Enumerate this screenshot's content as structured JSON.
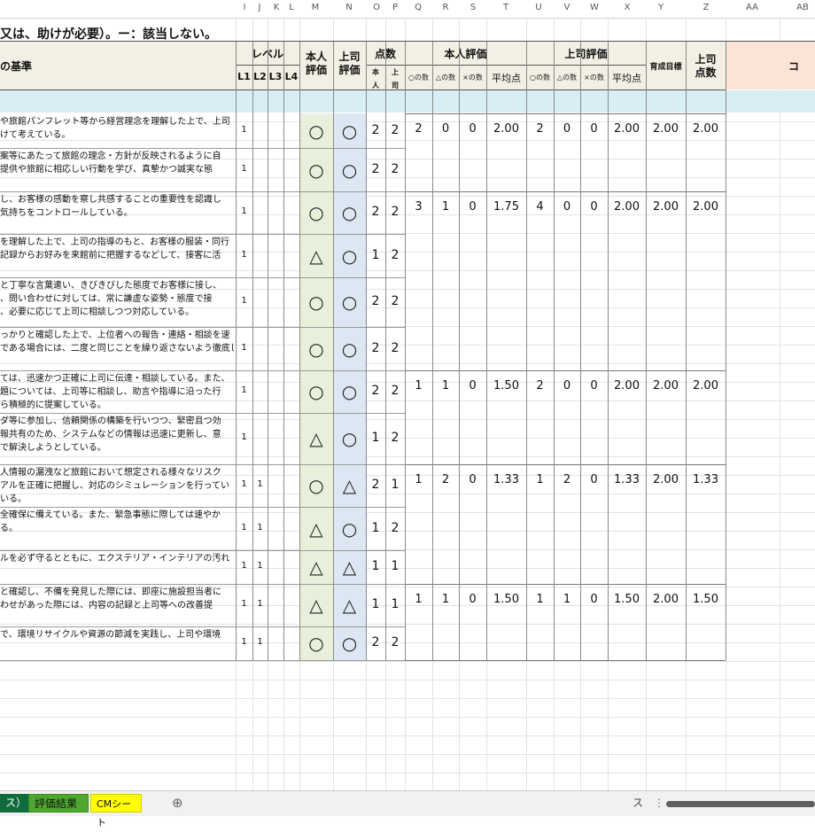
{
  "column_letters": [
    "I",
    "J",
    "K",
    "L",
    "M",
    "N",
    "O",
    "P",
    "Q",
    "R",
    "S",
    "T",
    "U",
    "V",
    "W",
    "X",
    "Y",
    "Z",
    "AA",
    "AB"
  ],
  "title_row": "又は、助けが必要）。ー：該当しない。",
  "headers": {
    "criteria": "の基準",
    "level": "レベル",
    "level_cols": [
      "L1",
      "L2",
      "L3",
      "L4"
    ],
    "self_eval": "本人\n評価",
    "boss_eval": "上司\n評価",
    "points": "点数",
    "points_sub": [
      "本\n人",
      "上\n司"
    ],
    "self_group": "本人評価",
    "boss_group": "上司評価",
    "count_cols": [
      "○の数",
      "△の数",
      "×の数"
    ],
    "avg": "平均点",
    "growth_target": "育成目標",
    "boss_points": "上司\n点数",
    "comment": "コ"
  },
  "rows": [
    {
      "criteria": "や旅館パンフレット等から経営理念を理解した上で、上司\nけて考えている。",
      "l1": "1",
      "l2": "",
      "self": "○",
      "boss": "○",
      "p_self": "2",
      "p_boss": "2"
    },
    {
      "criteria": "案等にあたって旅館の理念・方針が反映されるように自\n提供や旅館に相応しい行動を学び、真摯かつ誠実な態",
      "l1": "1",
      "l2": "",
      "self": "○",
      "boss": "○",
      "p_self": "2",
      "p_boss": "2"
    },
    {
      "criteria": "し、お客様の感動を察し共感することの重要性を認識し\n気持ちをコントロールしている。",
      "l1": "1",
      "l2": "",
      "self": "○",
      "boss": "○",
      "p_self": "2",
      "p_boss": "2"
    },
    {
      "criteria": "を理解した上で、上司の指導のもと、お客様の服装・同行\n記録からお好みを来館前に把握するなどして、接客に活",
      "l1": "1",
      "l2": "",
      "self": "△",
      "boss": "○",
      "p_self": "1",
      "p_boss": "2"
    },
    {
      "criteria": "と丁寧な言葉遣い、きびきびした態度でお客様に接し、\n、問い合わせに対しては、常に謙虚な姿勢・態度で接\n、必要に応じて上司に相談しつつ対応している。",
      "l1": "1",
      "l2": "",
      "self": "○",
      "boss": "○",
      "p_self": "2",
      "p_boss": "2"
    },
    {
      "criteria": "っかりと確認した上で、上位者への報告・連絡・相談を速\nである場合には、二度と同じことを繰り返さないよう徹底し",
      "l1": "1",
      "l2": "",
      "self": "○",
      "boss": "○",
      "p_self": "2",
      "p_boss": "2"
    },
    {
      "criteria": "ては、迅速かつ正確に上司に伝達・相談している。また、\n題については、上司等に相談し、助言や指導に沿った行\nら積極的に提案している。",
      "l1": "1",
      "l2": "",
      "self": "○",
      "boss": "○",
      "p_self": "2",
      "p_boss": "2"
    },
    {
      "criteria": "ダ等に参加し、信頼関係の構築を行いつつ、緊密且つ効\n報共有のため、システムなどの情報は迅速に更新し、意\nで解決しようとしている。",
      "l1": "1",
      "l2": "",
      "self": "△",
      "boss": "○",
      "p_self": "1",
      "p_boss": "2"
    },
    {
      "criteria": "人情報の漏洩など旅館において想定される様々なリスク\nアルを正確に把握し、対応のシミュレーションを行ってい\nいる。",
      "l1": "1",
      "l2": "1",
      "self": "○",
      "boss": "△",
      "p_self": "2",
      "p_boss": "1"
    },
    {
      "criteria": "全確保に備えている。また、緊急事態に際しては速やか\nる。",
      "l1": "1",
      "l2": "1",
      "self": "△",
      "boss": "○",
      "p_self": "1",
      "p_boss": "2"
    },
    {
      "criteria": "ルを必ず守るとともに、エクステリア・インテリアの汚れ",
      "l1": "1",
      "l2": "1",
      "self": "△",
      "boss": "△",
      "p_self": "1",
      "p_boss": "1"
    },
    {
      "criteria": "と確認し、不備を発見した際には、即座に施設担当者に\nわせがあった際には、内容の記録と上司等への改善提",
      "l1": "1",
      "l2": "1",
      "self": "△",
      "boss": "△",
      "p_self": "1",
      "p_boss": "1"
    },
    {
      "criteria": "で、環境リサイクルや資源の節減を実践し、上司や環境",
      "l1": "1",
      "l2": "1",
      "self": "○",
      "boss": "○",
      "p_self": "2",
      "p_boss": "2"
    }
  ],
  "groups": [
    {
      "self_o": "2",
      "self_t": "0",
      "self_x": "0",
      "self_avg": "2.00",
      "boss_o": "2",
      "boss_t": "0",
      "boss_x": "0",
      "boss_avg": "2.00",
      "target": "2.00",
      "boss_points": "2.00"
    },
    {
      "self_o": "3",
      "self_t": "1",
      "self_x": "0",
      "self_avg": "1.75",
      "boss_o": "4",
      "boss_t": "0",
      "boss_x": "0",
      "boss_avg": "2.00",
      "target": "2.00",
      "boss_points": "2.00"
    },
    {
      "self_o": "1",
      "self_t": "1",
      "self_x": "0",
      "self_avg": "1.50",
      "boss_o": "2",
      "boss_t": "0",
      "boss_x": "0",
      "boss_avg": "2.00",
      "target": "2.00",
      "boss_points": "2.00"
    },
    {
      "self_o": "1",
      "self_t": "2",
      "self_x": "0",
      "self_avg": "1.33",
      "boss_o": "1",
      "boss_t": "2",
      "boss_x": "0",
      "boss_avg": "1.33",
      "target": "2.00",
      "boss_points": "1.33"
    },
    {
      "self_o": "1",
      "self_t": "1",
      "self_x": "0",
      "self_avg": "1.50",
      "boss_o": "1",
      "boss_t": "1",
      "boss_x": "0",
      "boss_avg": "1.50",
      "target": "2.00",
      "boss_points": "1.50"
    }
  ],
  "tabs": {
    "partial": "ス）",
    "result": "評価結果",
    "cm": "CMシート",
    "add": "⊕",
    "right_partial": "ス"
  },
  "colors": {
    "header_bg": "#f2f0e4",
    "section_bg": "#d9eef4",
    "self_col_bg": "#e8f0dc",
    "boss_col_bg": "#dde7f3",
    "comment_bg": "#fbe4d5",
    "tab_result": "#4ea72e",
    "tab_cm": "#ffff00"
  }
}
